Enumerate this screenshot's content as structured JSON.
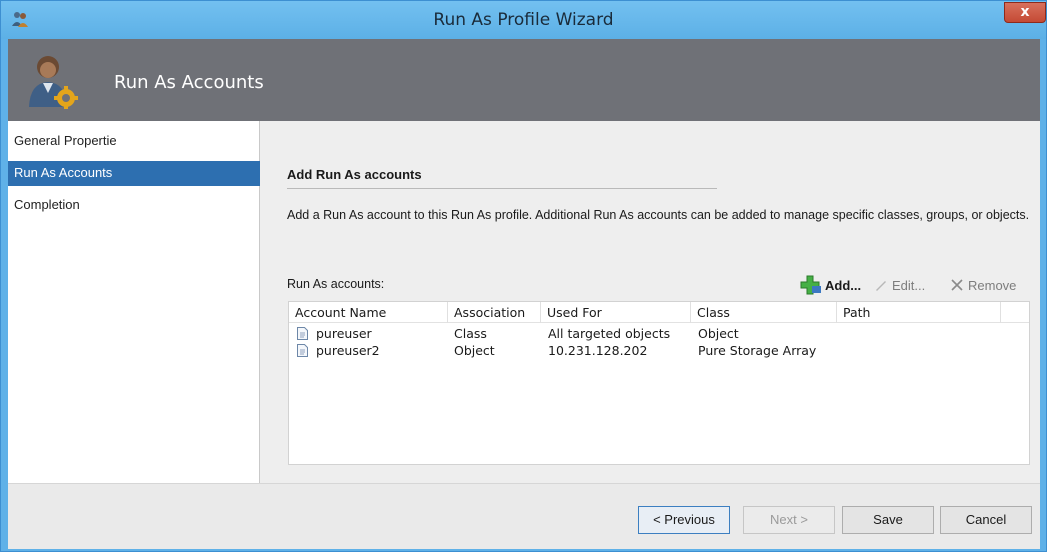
{
  "window": {
    "title": "Run As Profile Wizard",
    "close_label": "x",
    "app_icon": "people-icon"
  },
  "header": {
    "title": "Run As Accounts",
    "icon": "user-gear-icon"
  },
  "nav": {
    "items": [
      {
        "label": "General Propertie"
      },
      {
        "label": "Run As Accounts"
      },
      {
        "label": "Completion"
      }
    ],
    "active_index": 1
  },
  "page": {
    "section_title": "Add Run As accounts",
    "description": "Add a Run As account to this Run As profile.  Additional Run As accounts can be added to manage specific classes, groups, or objects.",
    "list_label": "Run As accounts:"
  },
  "toolbar": {
    "add_label": "Add...",
    "edit_label": "Edit...",
    "remove_label": "Remove"
  },
  "grid": {
    "columns": [
      "Account Name",
      "Association",
      "Used For",
      "Class",
      "Path"
    ],
    "rows": [
      {
        "account": "pureuser",
        "association": "Class",
        "used_for": "All targeted objects",
        "class": "Object",
        "path": ""
      },
      {
        "account": "pureuser2",
        "association": "Object",
        "used_for": "10.231.128.202",
        "class": "Pure Storage Array",
        "path": ""
      }
    ]
  },
  "footer": {
    "previous_label": "< Previous",
    "next_label": "Next >",
    "save_label": "Save",
    "cancel_label": "Cancel"
  },
  "colors": {
    "title_bar": "#5fb1e8",
    "header_band": "#6f7177",
    "nav_selected": "#2d6fb0",
    "add_icon": "#3aa33a"
  }
}
